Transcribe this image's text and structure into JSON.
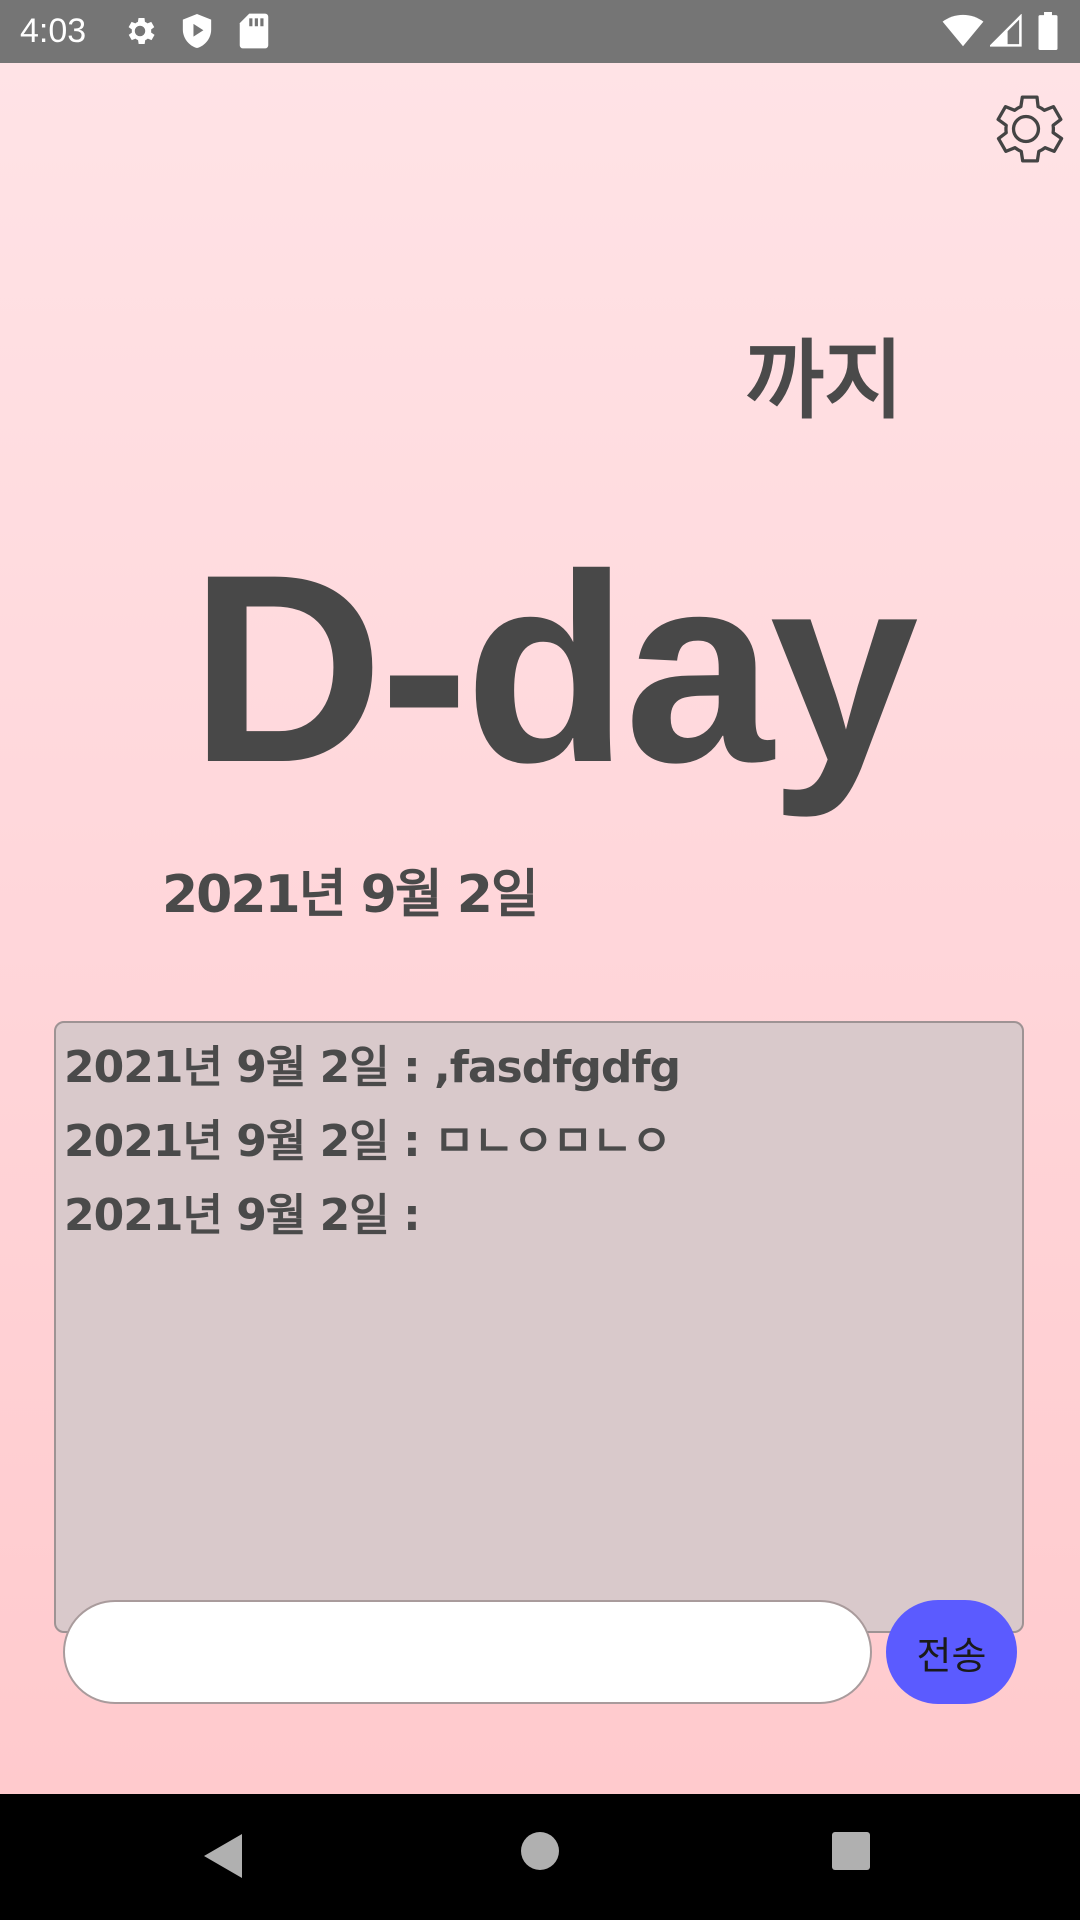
{
  "status_bar": {
    "time": "4:03",
    "icons_left": [
      "gear-icon",
      "shield-play-icon",
      "sd-card-icon"
    ],
    "icons_right": [
      "wifi-icon",
      "cellular-signal-icon",
      "battery-icon"
    ]
  },
  "header": {
    "settings_icon": "gear-icon"
  },
  "main": {
    "until_label": "까지",
    "title": "D-day",
    "target_date": "2021년 9월 2일"
  },
  "message_log": [
    {
      "text": "2021년 9월 2일 : ,fasdfgdfg"
    },
    {
      "text": "2021년 9월 2일 : ㅁㄴㅇㅁㄴㅇ"
    },
    {
      "text": "2021년 9월 2일 : "
    }
  ],
  "composer": {
    "input_value": "",
    "send_label": "전송"
  },
  "nav_bar": {
    "buttons": [
      "back-icon",
      "home-icon",
      "recents-icon"
    ]
  },
  "colors": {
    "status_bar": "#757575",
    "background_top": "#ffe3e6",
    "background_bottom": "#ffcacd",
    "text": "#4a4a4a",
    "log_background": "#d9c9cb",
    "send_button": "#5b5bff"
  }
}
